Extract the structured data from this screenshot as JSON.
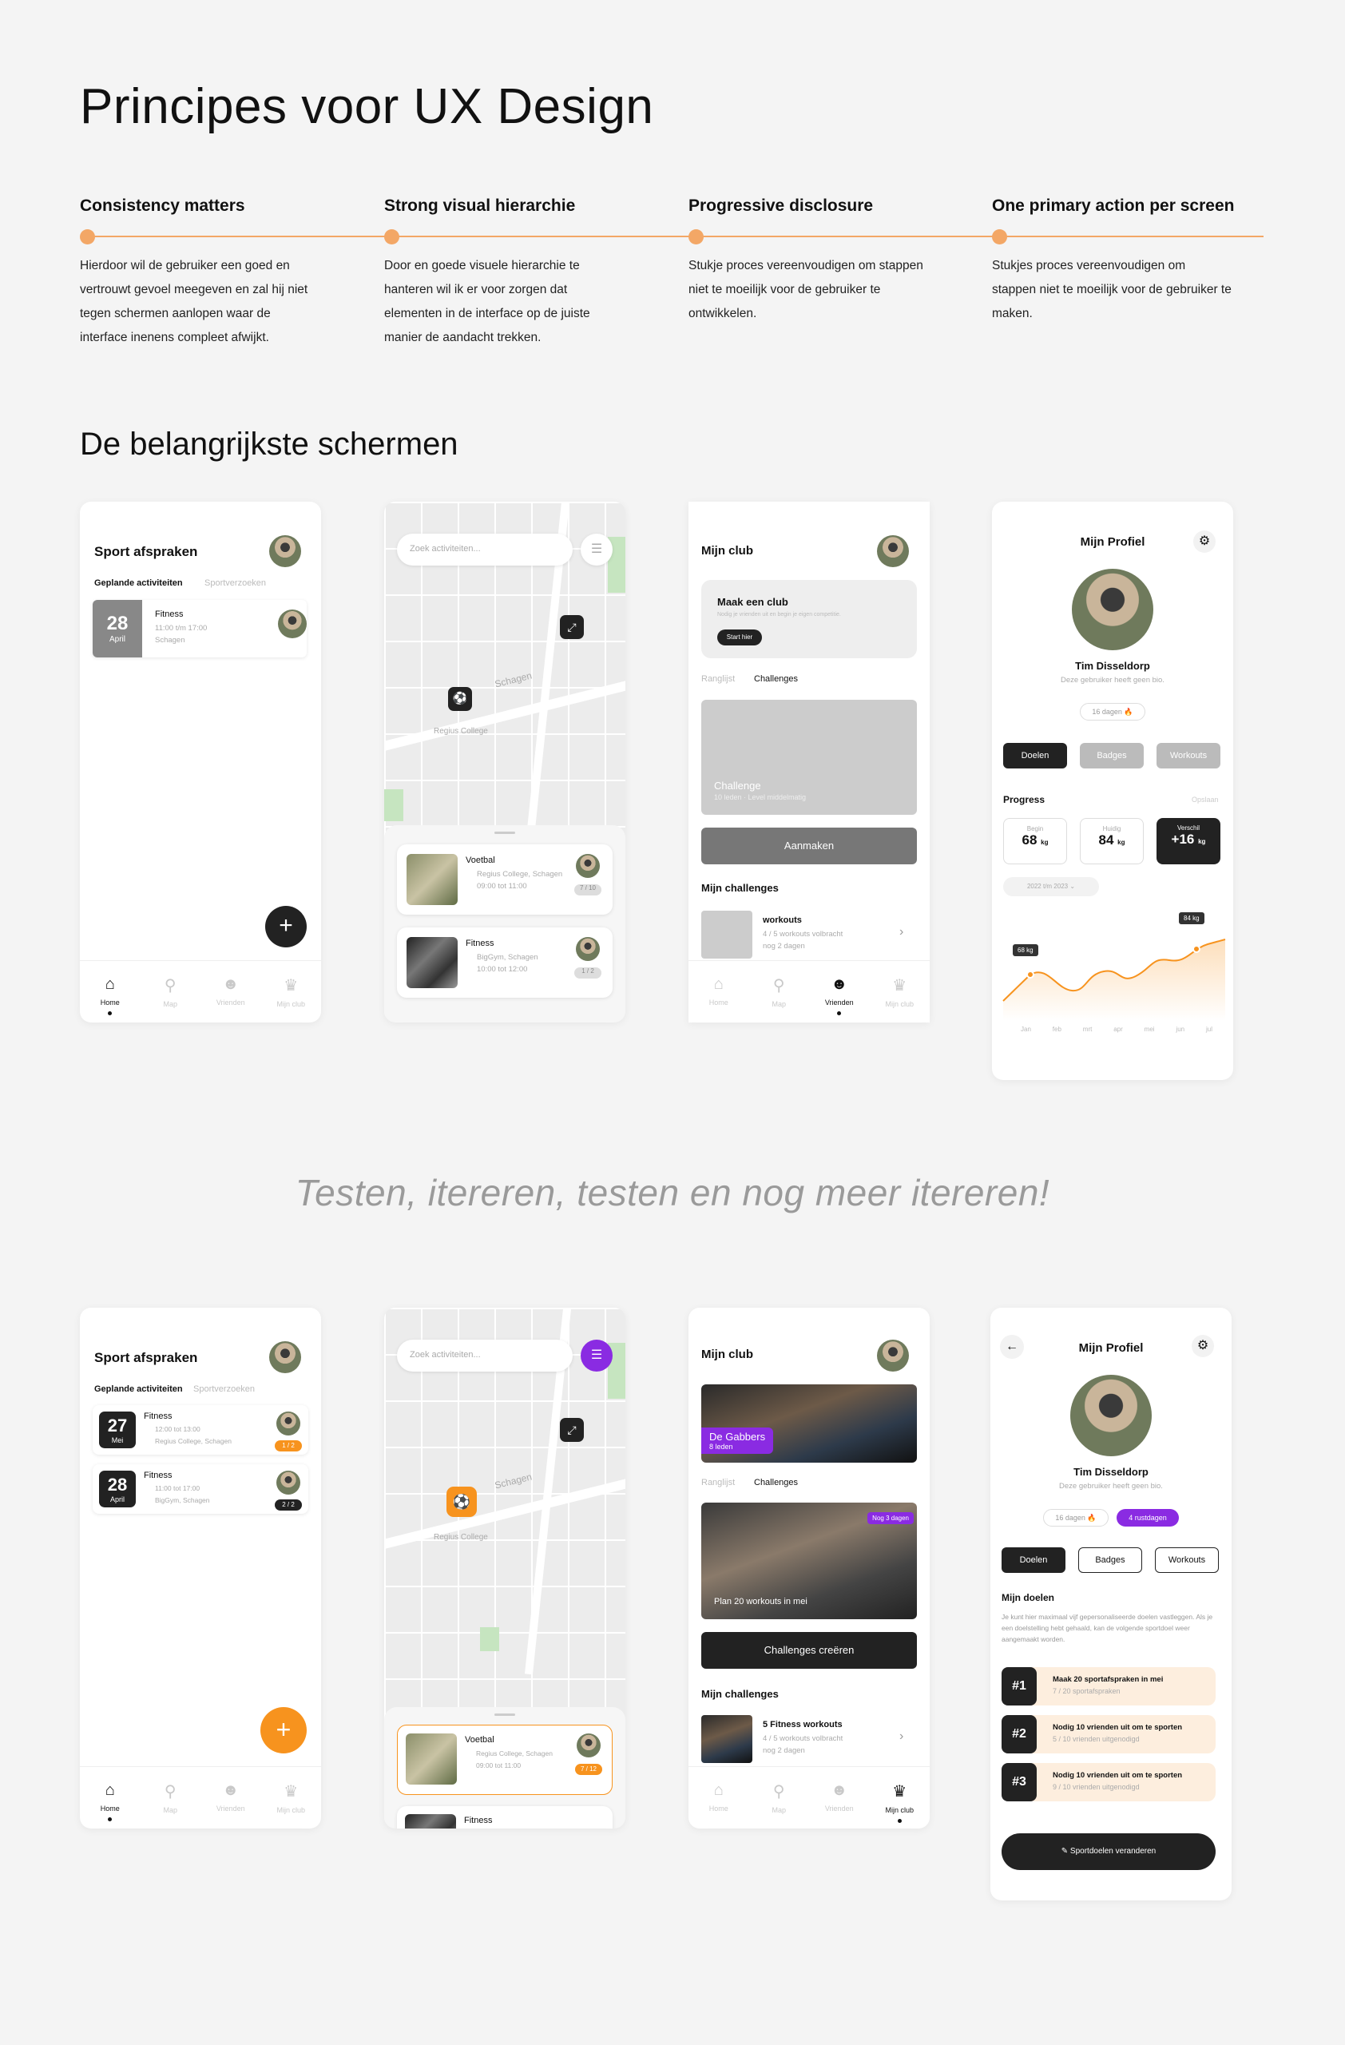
{
  "page": {
    "title": "Principes voor UX Design",
    "screens_heading": "De belangrijkste schermen",
    "slogan": "Testen, itereren, testen en nog meer itereren!"
  },
  "principles": [
    {
      "title": "Consistency matters",
      "text": "Hierdoor wil de gebruiker een goed en vertrouwt gevoel meegeven en zal hij niet tegen schermen aanlopen waar de interface inenens compleet afwijkt."
    },
    {
      "title": "Strong visual hierarchie",
      "text": "Door en goede visuele hierarchie te hanteren wil ik er voor zorgen dat elementen in de interface op de juiste manier de aandacht trekken."
    },
    {
      "title": "Progressive disclosure",
      "text": "Stukje proces vereenvoudigen om stappen niet te moeilijk voor de gebruiker te ontwikkelen."
    },
    {
      "title": "One primary action per screen",
      "text": "Stukjes proces vereenvoudigen om stappen niet te moeilijk voor de gebruiker te maken."
    }
  ],
  "nav": {
    "home": "Home",
    "map": "Map",
    "friends": "Vrienden",
    "club": "Mijn club"
  },
  "v1": {
    "sport": {
      "title": "Sport afspraken",
      "tab1": "Geplande activiteiten",
      "tab2": "Sportverzoeken",
      "day": "28",
      "month": "April",
      "act": "Fitness",
      "time": "11:00 t/m 17:00",
      "loc": "Schagen"
    },
    "map": {
      "search": "Zoek activiteiten...",
      "street": "Schagen",
      "place": "Regius College",
      "c1": {
        "t": "Voetbal",
        "l": "Regius College, Schagen",
        "time": "09:00 tot 11:00",
        "badge": "7 / 10"
      },
      "c2": {
        "t": "Fitness",
        "l": "BigGym, Schagen",
        "time": "10:00 tot 12:00",
        "badge": "1 / 2"
      }
    },
    "club": {
      "title": "Mijn club",
      "make": "Maak een club",
      "make_sub": "Nodig je vrienden uit en begin je eigen competitie.",
      "start": "Start hier",
      "tab1": "Ranglijst",
      "tab2": "Challenges",
      "ch_t": "Challenge",
      "ch_s": "10 leden · Level middelmatig",
      "aanmaken": "Aanmaken",
      "mine": "Mijn challenges",
      "w_t": "workouts",
      "w_s1": "4 / 5 workouts volbracht",
      "w_s2": "nog 2 dagen"
    },
    "profile": {
      "title": "Mijn Profiel",
      "name": "Tim Disseldorp",
      "bio": "Deze gebruiker heeft geen bio.",
      "streak": "16 dagen 🔥",
      "b1": "Doelen",
      "b2": "Badges",
      "b3": "Workouts",
      "progress": "Progress",
      "opslaan": "Opslaan",
      "begin_l": "Begin",
      "begin_v": "68",
      "huidig_l": "Huidig",
      "huidig_v": "84",
      "verschil_l": "Verschil",
      "verschil_v": "+16",
      "unit": "kg",
      "period": "2022 t/m 2023",
      "tag1": "68 kg",
      "tag2": "84 kg",
      "months": [
        "Jan",
        "feb",
        "mrt",
        "apr",
        "mei",
        "jun",
        "jul"
      ]
    }
  },
  "v2": {
    "sport": {
      "title": "Sport afspraken",
      "tab1": "Geplande activiteiten",
      "tab2": "Sportverzoeken",
      "items": [
        {
          "day": "27",
          "month": "Mei",
          "act": "Fitness",
          "time": "12:00 tot 13:00",
          "loc": "Regius College, Schagen",
          "badge": "1 / 2"
        },
        {
          "day": "28",
          "month": "April",
          "act": "Fitness",
          "time": "11:00 tot 17:00",
          "loc": "BigGym, Schagen",
          "badge": "2 / 2"
        }
      ]
    },
    "map": {
      "search": "Zoek activiteiten...",
      "street": "Schagen",
      "place": "Regius College",
      "c1": {
        "t": "Voetbal",
        "l": "Regius College, Schagen",
        "time": "09:00 tot 11:00",
        "badge": "7 / 12"
      },
      "c2": {
        "t": "Fitness"
      }
    },
    "club": {
      "title": "Mijn club",
      "club_name": "De Gabbers",
      "club_members": "8 leden",
      "tab1": "Ranglijst",
      "tab2": "Challenges",
      "badge": "Nog 3 dagen",
      "ch_text": "Plan 20 workouts in mei",
      "create": "Challenges creëren",
      "mine": "Mijn challenges",
      "w_t": "5 Fitness workouts",
      "w_s1": "4 / 5 workouts volbracht",
      "w_s2": "nog 2 dagen"
    },
    "profile": {
      "title": "Mijn Profiel",
      "name": "Tim Disseldorp",
      "bio": "Deze gebruiker heeft geen bio.",
      "streak": "16 dagen 🔥",
      "rest": "4 rustdagen",
      "b1": "Doelen",
      "b2": "Badges",
      "b3": "Workouts",
      "goals_title": "Mijn doelen",
      "goals_text": "Je kunt hier maximaal vijf gepersonaliseerde doelen vastleggen. Als je een doelstelling hebt gehaald, kan de volgende sportdoel weer aangemaakt worden.",
      "goals": [
        {
          "n": "#1",
          "t": "Maak 20 sportafspraken in mei",
          "s": "7 / 20 sportafspraken"
        },
        {
          "n": "#2",
          "t": "Nodig 10 vrienden uit om te sporten",
          "s": "5 / 10 vrienden uitgenodigd"
        },
        {
          "n": "#3",
          "t": "Nodig 10 vrienden uit om te sporten",
          "s": "9 / 10 vrienden uitgenodigd"
        }
      ],
      "change": "Sportdoelen veranderen"
    }
  },
  "colors": {
    "accent": "#f3a766",
    "orange": "#f7931e",
    "purple": "#8a2be2",
    "dark": "#222222"
  }
}
